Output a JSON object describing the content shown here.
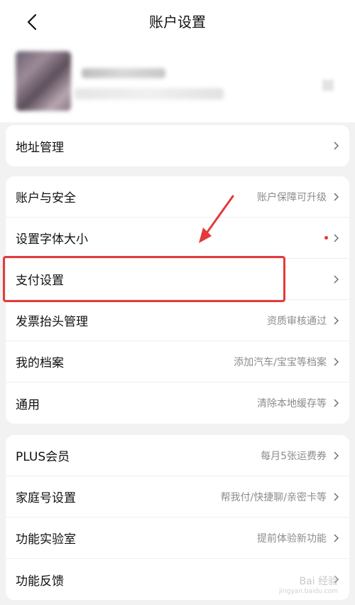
{
  "header": {
    "title": "账户设置"
  },
  "sections": [
    {
      "rows": [
        {
          "label": "地址管理",
          "value": ""
        }
      ]
    },
    {
      "rows": [
        {
          "label": "账户与安全",
          "value": "账户保障可升级"
        },
        {
          "label": "设置字体大小",
          "value": "",
          "badge": "red-dot"
        },
        {
          "label": "支付设置",
          "value": ""
        },
        {
          "label": "发票抬头管理",
          "value": "资质审核通过"
        },
        {
          "label": "我的档案",
          "value": "添加汽车/宝宝等档案"
        },
        {
          "label": "通用",
          "value": "清除本地缓存等"
        }
      ]
    },
    {
      "rows": [
        {
          "label": "PLUS会员",
          "value": "每月5张运费券"
        },
        {
          "label": "家庭号设置",
          "value": "帮我付/快捷聊/亲密卡等"
        },
        {
          "label": "功能实验室",
          "value": "提前体验新功能"
        },
        {
          "label": "功能反馈",
          "value": ""
        }
      ]
    }
  ],
  "watermark": {
    "main": "Bai 经验",
    "sub": "jingyan.baidu.com"
  },
  "colors": {
    "highlight": "#e23b3b",
    "badge": "#e53935"
  }
}
